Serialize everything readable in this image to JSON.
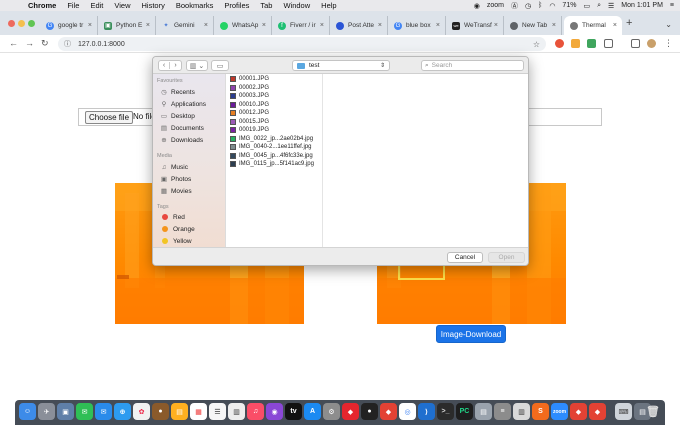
{
  "menubar": {
    "app": "Chrome",
    "items": [
      "File",
      "Edit",
      "View",
      "History",
      "Bookmarks",
      "Profiles",
      "Tab",
      "Window",
      "Help"
    ],
    "zoom_label": "zoom",
    "battery": "71%",
    "clock": "Mon 1:01 PM"
  },
  "tabs": [
    {
      "title": "google tr",
      "fav": "G",
      "color": "#4285f4"
    },
    {
      "title": "Python E",
      "fav": "▣",
      "color": "#3a8f5c"
    },
    {
      "title": "Gemini",
      "fav": "✦",
      "color": "#4a7bd6"
    },
    {
      "title": "WhatsAp",
      "fav": "●",
      "color": "#25d366"
    },
    {
      "title": "Fiverr / ir",
      "fav": "f",
      "color": "#1dbf73"
    },
    {
      "title": "Post Atte",
      "fav": "●",
      "color": "#2b55d6"
    },
    {
      "title": "blue box",
      "fav": "G",
      "color": "#4285f4"
    },
    {
      "title": "WeTransf",
      "fav": "we",
      "color": "#222222"
    },
    {
      "title": "New Tab",
      "fav": "●",
      "color": "#5f6368"
    },
    {
      "title": "Thermal",
      "fav": "●",
      "color": "#777777"
    }
  ],
  "address_bar": {
    "url": "127.0.0.1:8000"
  },
  "page": {
    "choose_file_label": "Choose file",
    "no_file_text": "No file chosen",
    "download_button": "Image-Download"
  },
  "dialog": {
    "location": "test",
    "search_placeholder": "Search",
    "sidebar": {
      "favourites_header": "Favourites",
      "favourites": [
        "Recents",
        "Applications",
        "Desktop",
        "Documents",
        "Downloads"
      ],
      "media_header": "Media",
      "media": [
        "Music",
        "Photos",
        "Movies"
      ],
      "tags_header": "Tags",
      "tags": [
        {
          "name": "Red",
          "color": "#e8473e"
        },
        {
          "name": "Orange",
          "color": "#f4941c"
        },
        {
          "name": "Yellow",
          "color": "#f2c524"
        }
      ]
    },
    "files": [
      "00001.JPG",
      "00002.JPG",
      "00003.JPG",
      "00010.JPG",
      "00012.JPG",
      "00015.JPG",
      "00019.JPG",
      "IMG_0022_jp...2ae02b4.jpg",
      "IMG_0040-2...1ee11ffef.jpg",
      "IMG_0045_jp...4f6fc33e.jpg",
      "IMG_0115_jp...5f141ac9.jpg"
    ],
    "cancel_label": "Cancel",
    "open_label": "Open"
  },
  "colors": {
    "accent_blue": "#1a73e8",
    "thermal_orange": "#ff8a00"
  }
}
